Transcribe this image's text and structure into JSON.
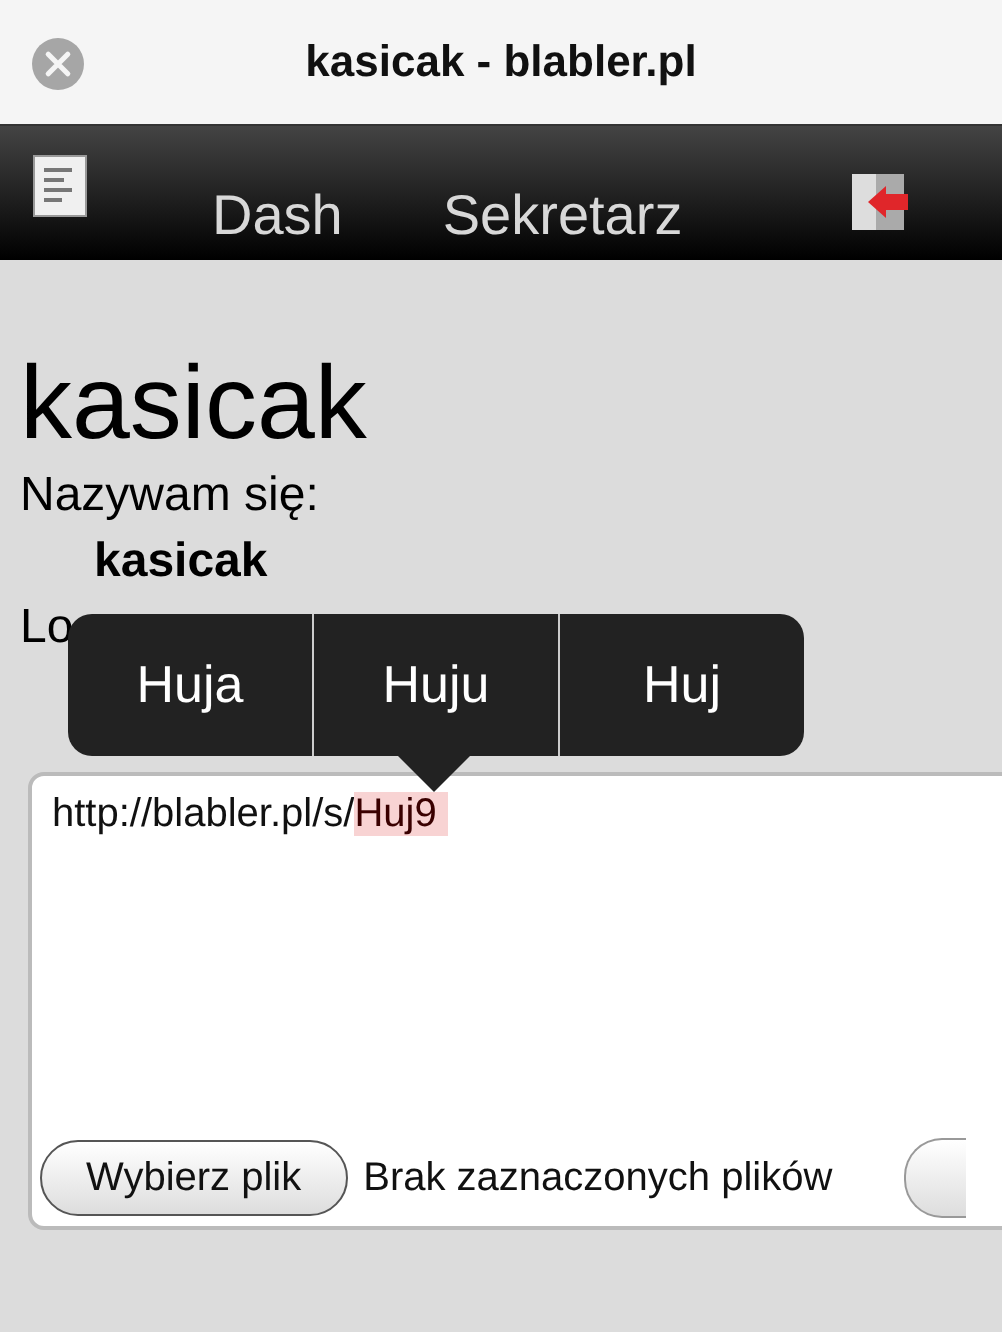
{
  "window": {
    "title": "kasicak - blabler.pl"
  },
  "nav": {
    "items": [
      {
        "label": "Dash"
      },
      {
        "label": "Sekretarz"
      }
    ]
  },
  "profile": {
    "heading": "kasicak",
    "name_label": "Nazywam się:",
    "name": "kasicak",
    "cut_label": "Lo"
  },
  "suggestions": [
    "Huja",
    "Huju",
    "Huj"
  ],
  "editor": {
    "text": "http://blabler.pl/s/",
    "marked": "Huj9"
  },
  "file_picker": {
    "button": "Wybierz plik",
    "status": "Brak zaznaczonych plików"
  }
}
